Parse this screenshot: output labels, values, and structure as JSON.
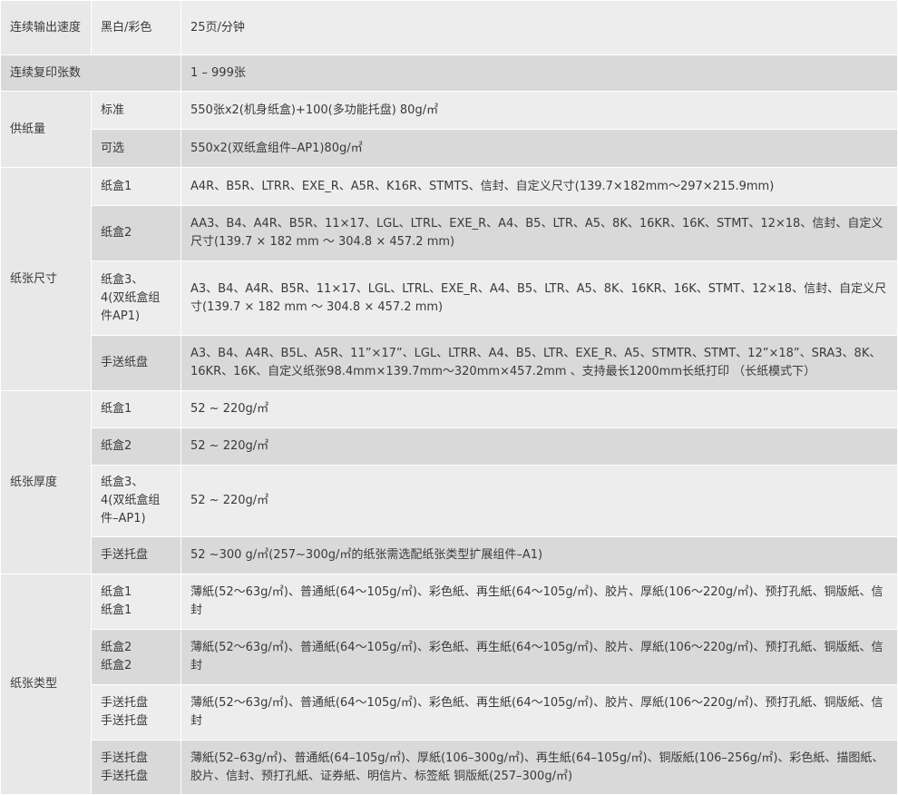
{
  "rows": {
    "speed": {
      "label": "连续输出速度",
      "sub": "黑白/彩色",
      "value": "25页/分钟"
    },
    "copies": {
      "label": "连续复印张数",
      "value": "1 – 999张"
    },
    "supply": {
      "label": "供纸量",
      "items": [
        {
          "sub": "标准",
          "value": "550张x2(机身纸盒)+100(多功能托盘) 80g/㎡"
        },
        {
          "sub": "可选",
          "value": "550x2(双纸盒组件–AP1)80g/㎡"
        }
      ]
    },
    "size": {
      "label": "纸张尺寸",
      "items": [
        {
          "sub": "纸盒1",
          "value": "A4R、B5R、LTRR、EXE_R、A5R、K16R、STMTS、信封、自定义尺寸(139.7×182mm〜297×215.9mm)"
        },
        {
          "sub": "纸盒2",
          "value": "AA3、B4、A4R、B5R、11×17、LGL、LTRL、EXE_R、A4、B5、LTR、A5、8K、16KR、16K、STMT、12×18、信封、自定义尺寸(139.7 × 182 mm 〜 304.8 × 457.2 mm)"
        },
        {
          "sub": "纸盒3、\n4(双纸盒组件AP1)",
          "value": "A3、B4、A4R、B5R、11×17、LGL、LTRL、EXE_R、A4、B5、LTR、A5、8K、16KR、16K、STMT、12×18、信封、自定义尺寸(139.7 × 182 mm 〜 304.8 × 457.2 mm)"
        },
        {
          "sub": "手送纸盘",
          "value": "A3、B4、A4R、B5L、A5R、11”×17”、LGL、LTRR、A4、B5、LTR、EXE_R、A5、STMTR、STMT、12”×18”、SRA3、8K、16KR、16K、自定义纸张98.4mm×139.7mm〜320mm×457.2mm 、支持最长1200mm长纸打印 （长纸模式下）"
        }
      ]
    },
    "weight": {
      "label": "纸张厚度",
      "items": [
        {
          "sub": "纸盒1",
          "value": "52 ~ 220g/㎡"
        },
        {
          "sub": "纸盒2",
          "value": "52 ~ 220g/㎡"
        },
        {
          "sub": "纸盒3、\n4(双纸盒组件–AP1)",
          "value": "52 ~ 220g/㎡"
        },
        {
          "sub": "手送托盘",
          "value": "52 ~300 g/㎡(257~300g/㎡的纸张需选配纸张类型扩展组件–A1)"
        }
      ]
    },
    "type": {
      "label": "纸张类型",
      "items": [
        {
          "sub": "纸盒1\n纸盒1",
          "value": "薄紙(52〜63g/㎡)、普通紙(64〜105g/㎡)、彩色紙、再生紙(64〜105g/㎡)、胶片、厚紙(106〜220g/㎡)、预打孔紙、铜版紙、信封"
        },
        {
          "sub": "纸盒2\n纸盒2",
          "value": "薄紙(52〜63g/㎡)、普通紙(64〜105g/㎡)、彩色紙、再生紙(64〜105g/㎡)、胶片、厚紙(106〜220g/㎡)、预打孔紙、铜版紙、信封"
        },
        {
          "sub": "手送托盘\n手送托盘",
          "value": "薄紙(52〜63g/㎡)、普通紙(64〜105g/㎡)、彩色紙、再生紙(64〜105g/㎡)、胶片、厚紙(106〜220g/㎡)、预打孔紙、铜版紙、信封"
        },
        {
          "sub": "手送托盘\n手送托盘",
          "value": "薄紙(52–63g/㎡)、普通紙(64–105g/㎡)、厚紙(106–300g/㎡)、再生紙(64–105g/㎡)、铜版紙(106–256g/㎡)、彩色紙、描图紙、胶片、信封、预打孔紙、证券紙、明信片、标签紙 铜版紙(257–300g/㎡)"
        }
      ]
    }
  }
}
